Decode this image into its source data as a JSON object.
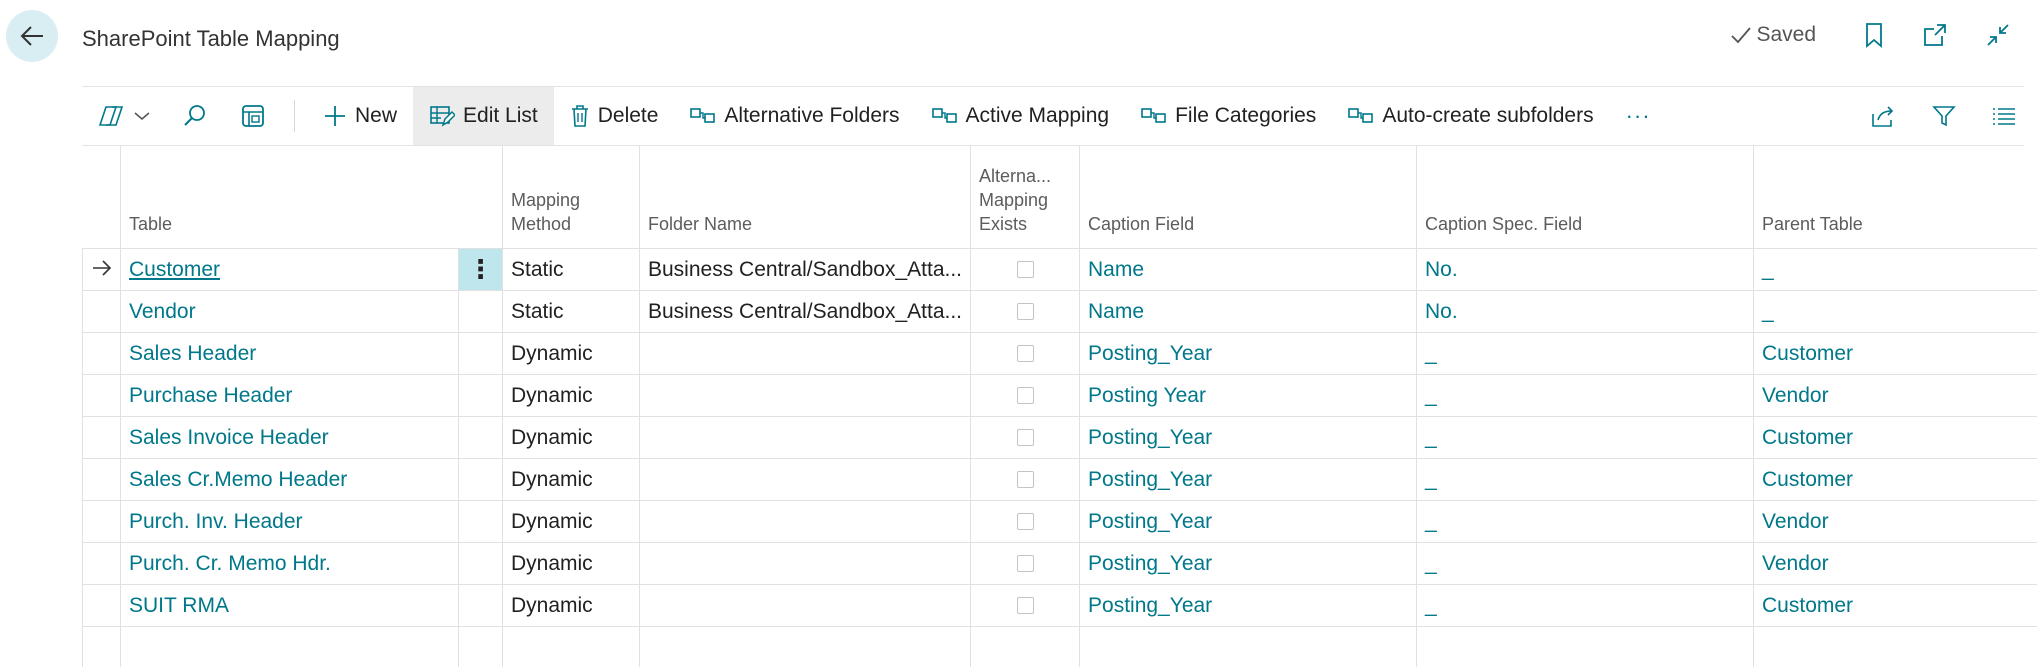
{
  "header": {
    "title": "SharePoint Table Mapping",
    "saved_label": "Saved"
  },
  "actions": {
    "new_label": "New",
    "edit_list_label": "Edit List",
    "delete_label": "Delete",
    "alt_folders_label": "Alternative Folders",
    "active_mapping_label": "Active Mapping",
    "file_categories_label": "File Categories",
    "auto_subfolders_label": "Auto-create subfolders",
    "more_label": "···"
  },
  "columns": {
    "table": "Table",
    "mapping_method_l1": "Mapping",
    "mapping_method_l2": "Method",
    "folder_name": "Folder Name",
    "alt_l1": "Alterna...",
    "alt_l2": "Mapping",
    "alt_l3": "Exists",
    "caption_field": "Caption Field",
    "caption_spec": "Caption Spec. Field",
    "parent_table": "Parent Table"
  },
  "rows": [
    {
      "table": "Customer",
      "method": "Static",
      "folder": "Business Central/Sandbox_Atta...",
      "alt_exists": false,
      "caption": "Name",
      "spec": "No.",
      "parent": "_"
    },
    {
      "table": "Vendor",
      "method": "Static",
      "folder": "Business Central/Sandbox_Atta...",
      "alt_exists": false,
      "caption": "Name",
      "spec": "No.",
      "parent": "_"
    },
    {
      "table": "Sales Header",
      "method": "Dynamic",
      "folder": "",
      "alt_exists": false,
      "caption": "Posting_Year",
      "spec": "_",
      "parent": "Customer"
    },
    {
      "table": "Purchase Header",
      "method": "Dynamic",
      "folder": "",
      "alt_exists": false,
      "caption": "Posting Year",
      "spec": "_",
      "parent": "Vendor"
    },
    {
      "table": "Sales Invoice Header",
      "method": "Dynamic",
      "folder": "",
      "alt_exists": false,
      "caption": "Posting_Year",
      "spec": "_",
      "parent": "Customer"
    },
    {
      "table": "Sales Cr.Memo Header",
      "method": "Dynamic",
      "folder": "",
      "alt_exists": false,
      "caption": "Posting_Year",
      "spec": "_",
      "parent": "Customer"
    },
    {
      "table": "Purch. Inv. Header",
      "method": "Dynamic",
      "folder": "",
      "alt_exists": false,
      "caption": "Posting_Year",
      "spec": "_",
      "parent": "Vendor"
    },
    {
      "table": "Purch. Cr. Memo Hdr.",
      "method": "Dynamic",
      "folder": "",
      "alt_exists": false,
      "caption": "Posting_Year",
      "spec": "_",
      "parent": "Vendor"
    },
    {
      "table": "SUIT RMA",
      "method": "Dynamic",
      "folder": "",
      "alt_exists": false,
      "caption": "Posting_Year",
      "spec": "_",
      "parent": "Customer"
    }
  ],
  "colors": {
    "accent": "#00788a",
    "back_button_bg": "#d8eef2",
    "selected_cell_bg": "#bfe6ec"
  }
}
